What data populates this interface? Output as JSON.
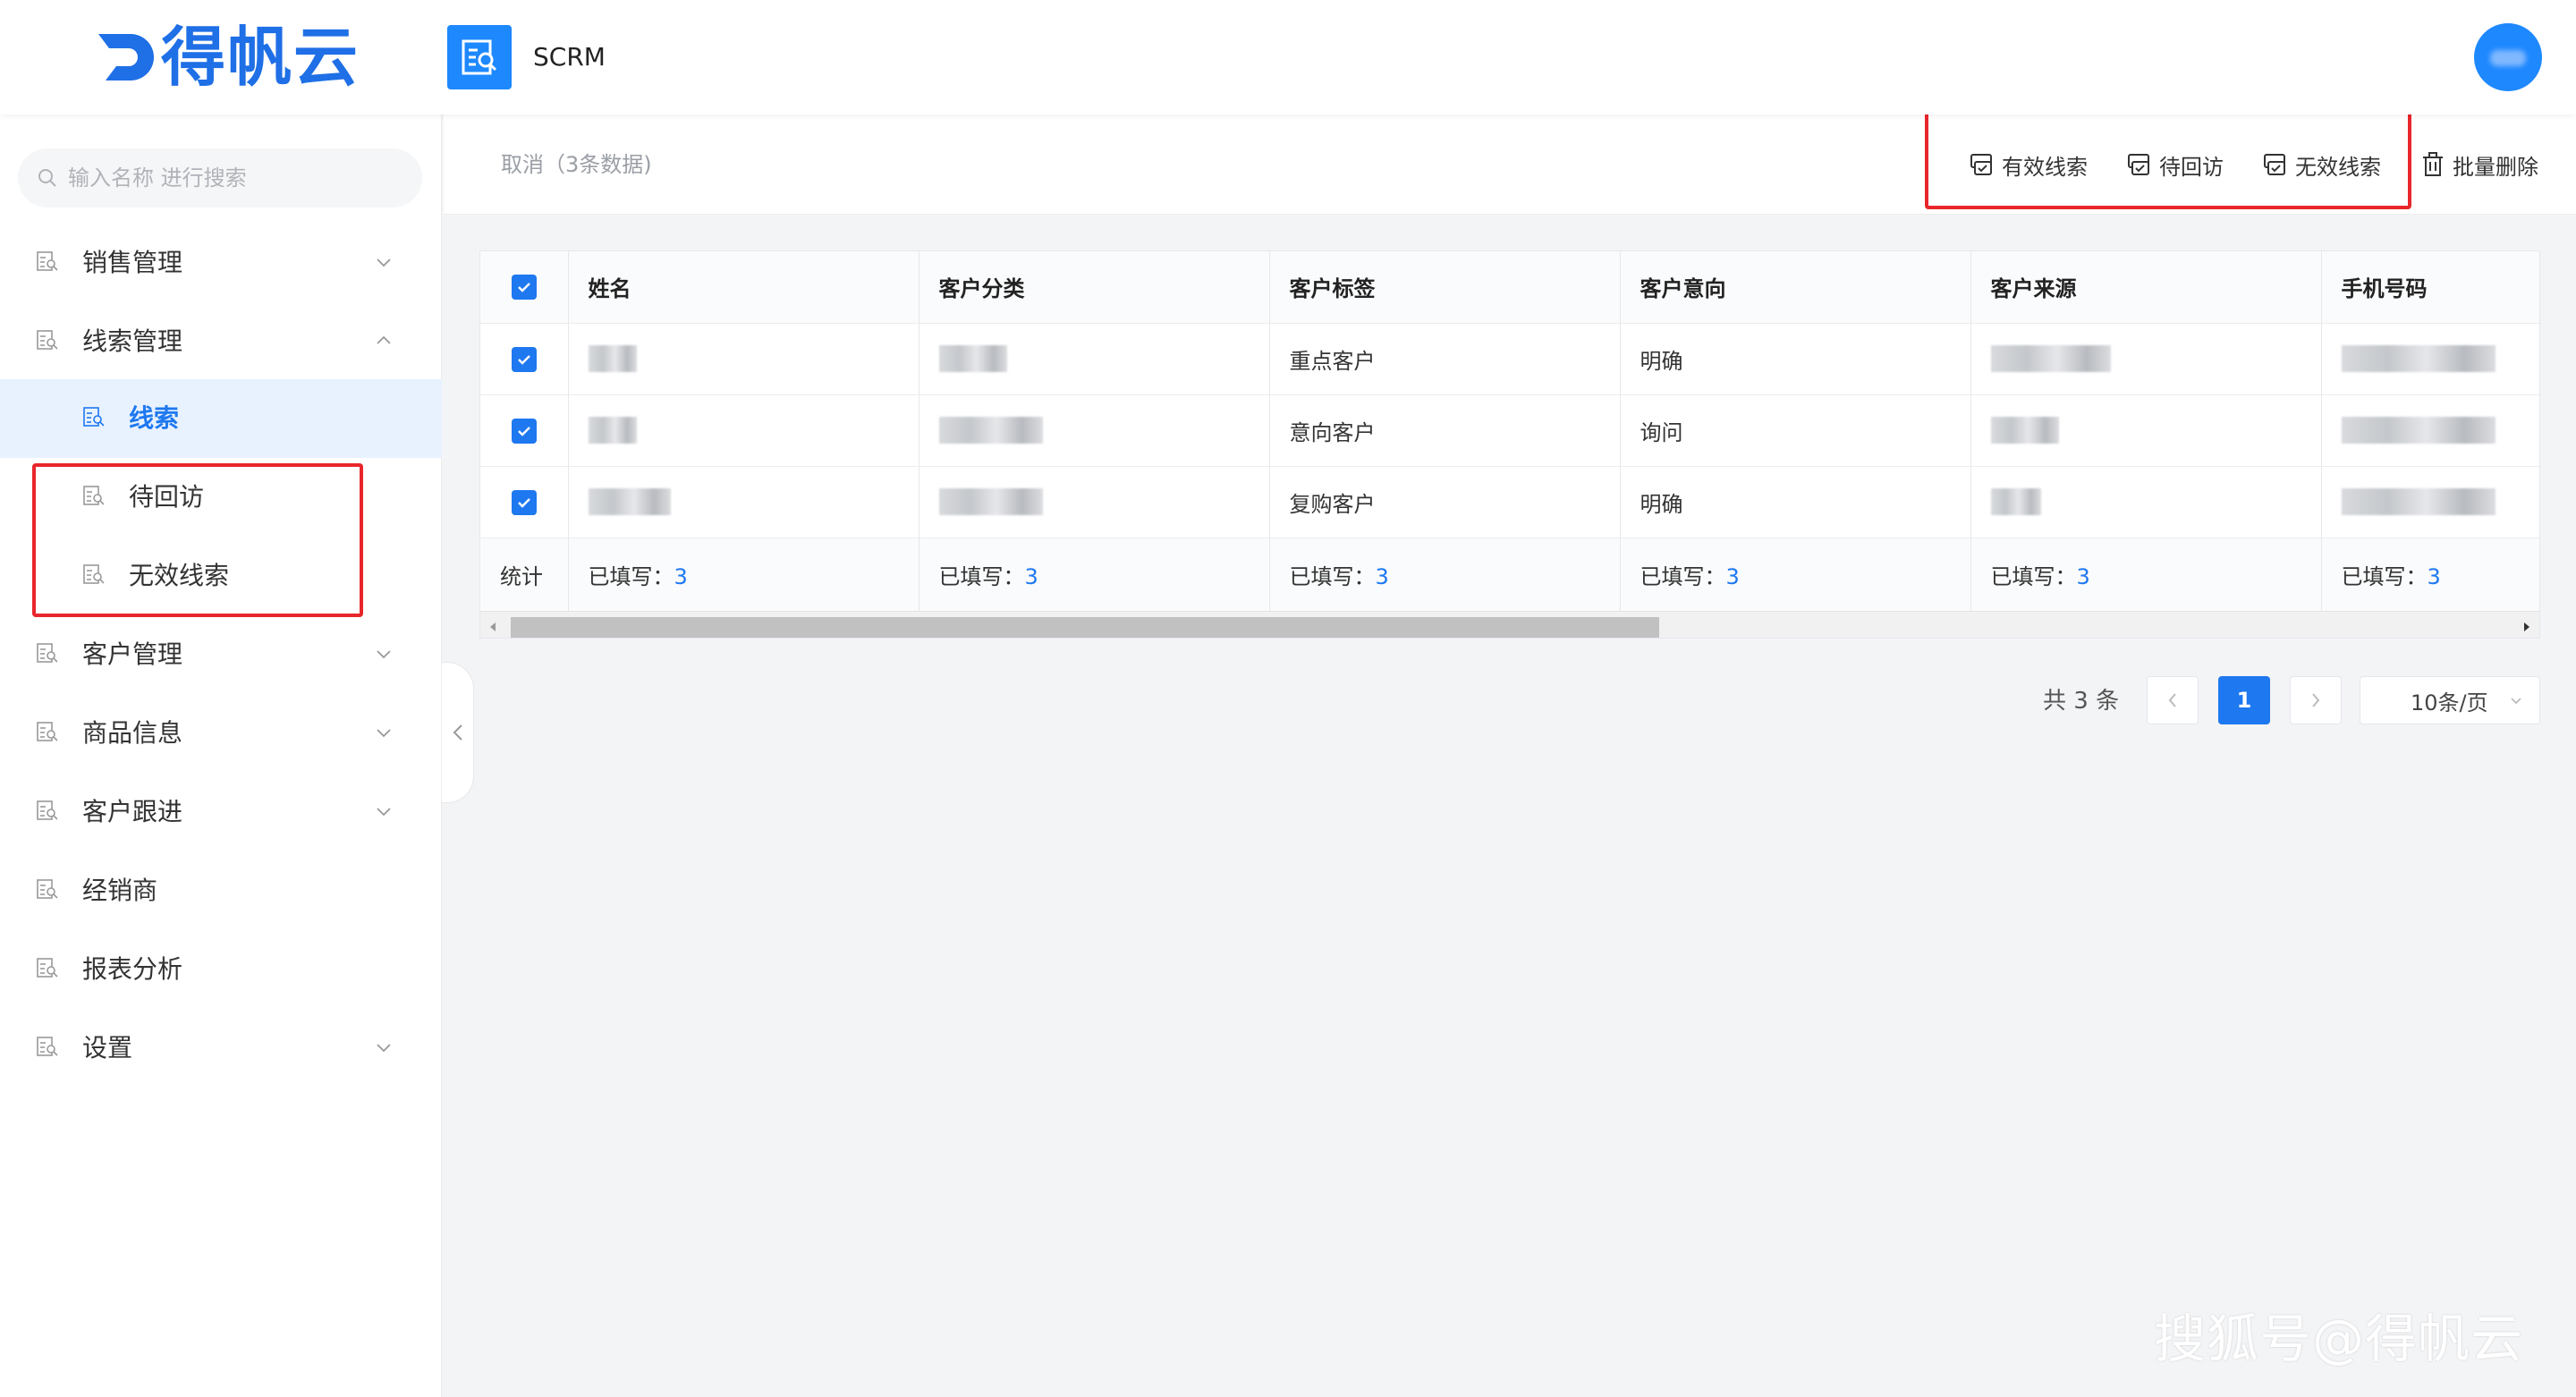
{
  "header": {
    "logo_text": "得帆云",
    "app_name": "SCRM"
  },
  "sidebar": {
    "search_placeholder": "输入名称 进行搜索",
    "items": [
      {
        "label": "销售管理"
      },
      {
        "label": "线索管理"
      },
      {
        "label": "线索"
      },
      {
        "label": "待回访"
      },
      {
        "label": "无效线索"
      },
      {
        "label": "客户管理"
      },
      {
        "label": "商品信息"
      },
      {
        "label": "客户跟进"
      },
      {
        "label": "经销商"
      },
      {
        "label": "报表分析"
      },
      {
        "label": "设置"
      }
    ]
  },
  "toolbar": {
    "cancel_text": "取消（3条数据)",
    "valid_leads": "有效线索",
    "pending_visit": "待回访",
    "invalid_leads": "无效线索",
    "batch_delete": "批量删除"
  },
  "table": {
    "headers": [
      "姓名",
      "客户分类",
      "客户标签",
      "客户意向",
      "客户来源",
      "手机号码"
    ],
    "rows": [
      {
        "tag": "重点客户",
        "intent": "明确"
      },
      {
        "tag": "意向客户",
        "intent": "询问"
      },
      {
        "tag": "复购客户",
        "intent": "明确"
      }
    ],
    "summary_label": "统计",
    "filled_label": "已填写：",
    "filled_value": "3"
  },
  "pagination": {
    "total": "共 3 条",
    "current_page": "1",
    "page_size": "10条/页"
  },
  "watermark": "搜狐号@得帆云",
  "colors": {
    "accent": "#1e78f0",
    "highlight_box": "#e8262b"
  }
}
